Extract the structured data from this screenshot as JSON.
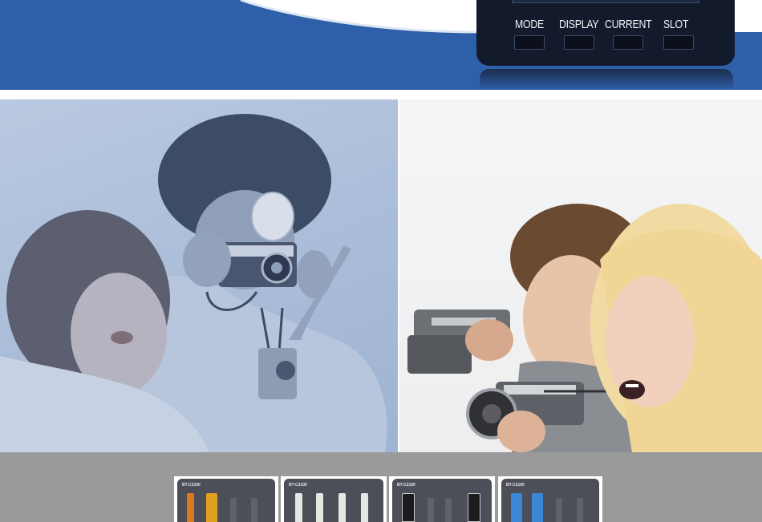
{
  "device": {
    "buttons": [
      {
        "label": "MODE"
      },
      {
        "label": "DISPLAY"
      },
      {
        "label": "CURRENT"
      },
      {
        "label": "SLOT"
      }
    ]
  },
  "chargers": [
    {
      "model": "BT-C3100",
      "cells": [
        "orange",
        "yellow",
        "empty",
        "empty"
      ]
    },
    {
      "model": "BT-C3100",
      "cells": [
        "white",
        "white",
        "white",
        "white"
      ]
    },
    {
      "model": "BT-C3100",
      "cells": [
        "black",
        "empty",
        "empty",
        "black"
      ]
    },
    {
      "model": "BT-C3100",
      "cells": [
        "blue",
        "blue",
        "empty",
        "empty"
      ]
    }
  ],
  "colors": {
    "banner_blue": "#2e5fa9",
    "device_black": "#131a2b",
    "strip_gray": "#9a9a9a",
    "left_tint": "#a9bcd8"
  }
}
